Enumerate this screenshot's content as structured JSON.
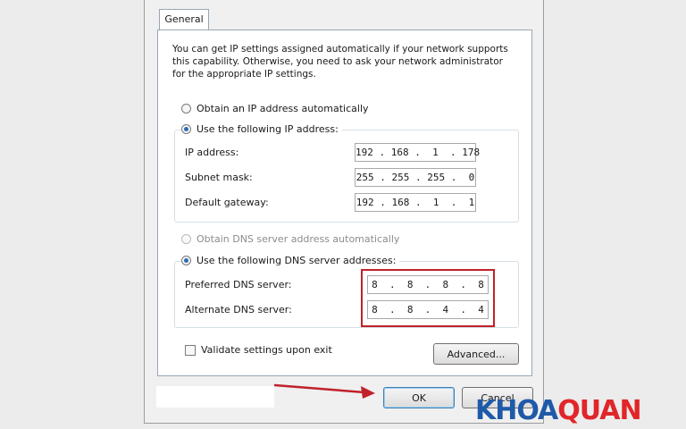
{
  "tabs": [
    {
      "label": "General",
      "active": true
    }
  ],
  "description": [
    "You can get IP settings assigned automatically if your network supports",
    "this capability. Otherwise, you need to ask your network administrator",
    "for the appropriate IP settings."
  ],
  "ip": {
    "auto_label": "Obtain an IP address automatically",
    "manual_label": "Use the following IP address:",
    "selected": "manual",
    "fields": [
      {
        "label": "IP address:",
        "value": "192 . 168 .  1  . 178"
      },
      {
        "label": "Subnet mask:",
        "value": "255 . 255 . 255 .  0"
      },
      {
        "label": "Default gateway:",
        "value": "192 . 168 .  1  .  1"
      }
    ]
  },
  "dns": {
    "auto_label": "Obtain DNS server address automatically",
    "auto_disabled": true,
    "manual_label": "Use the following DNS server addresses:",
    "selected": "manual",
    "fields": [
      {
        "label": "Preferred DNS server:",
        "value": "8  .  8  .  8  .  8"
      },
      {
        "label": "Alternate DNS server:",
        "value": "8  .  8  .  4  .  4"
      }
    ]
  },
  "validate": {
    "label": "Validate settings upon exit",
    "checked": false
  },
  "buttons": {
    "advanced": "Advanced...",
    "ok": "OK",
    "cancel": "Cancel"
  },
  "logo": {
    "part1": "KHOA",
    "part2": "QUAN"
  },
  "colors": {
    "highlight": "#c0212a",
    "logo_blue": "#1f5aa8",
    "logo_red": "#e0262a",
    "radio_dot": "#2b6bb8"
  }
}
